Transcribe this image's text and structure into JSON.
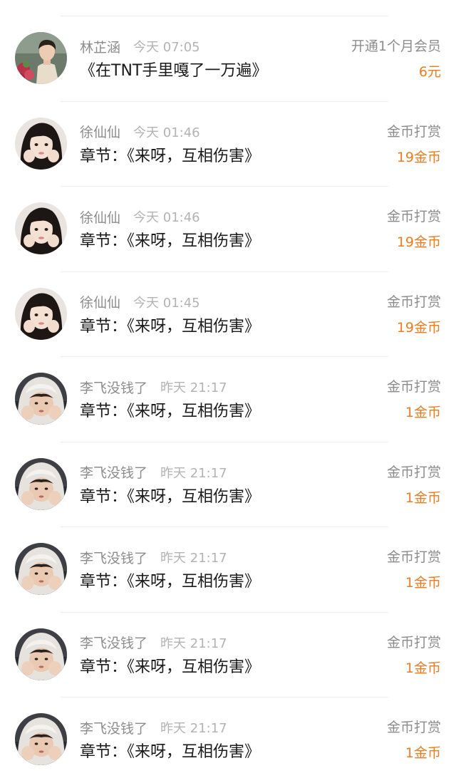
{
  "accent_color": "#f07b1c",
  "records": [
    {
      "avatar_icon": "avatar-photo-man-with-flowers",
      "username": "林芷涵",
      "time": "今天 07:05",
      "content": "《在TNT手里嘎了一万遍》",
      "type": "开通1个月会员",
      "amount": "6元"
    },
    {
      "avatar_icon": "avatar-photo-woman-hands-on-cheeks",
      "username": "徐仙仙",
      "time": "今天 01:46",
      "content": "章节：《来呀，互相伤害》",
      "type": "金币打赏",
      "amount": "19金币"
    },
    {
      "avatar_icon": "avatar-photo-woman-hands-on-cheeks",
      "username": "徐仙仙",
      "time": "今天 01:46",
      "content": "章节：《来呀，互相伤害》",
      "type": "金币打赏",
      "amount": "19金币"
    },
    {
      "avatar_icon": "avatar-photo-woman-hands-on-cheeks",
      "username": "徐仙仙",
      "time": "今天 01:45",
      "content": "章节：《来呀，互相伤害》",
      "type": "金币打赏",
      "amount": "19金币"
    },
    {
      "avatar_icon": "avatar-photo-person-white-hood",
      "username": "李飞没钱了",
      "time": "昨天 21:17",
      "content": "章节：《来呀，互相伤害》",
      "type": "金币打赏",
      "amount": "1金币"
    },
    {
      "avatar_icon": "avatar-photo-person-white-hood",
      "username": "李飞没钱了",
      "time": "昨天 21:17",
      "content": "章节：《来呀，互相伤害》",
      "type": "金币打赏",
      "amount": "1金币"
    },
    {
      "avatar_icon": "avatar-photo-person-white-hood",
      "username": "李飞没钱了",
      "time": "昨天 21:17",
      "content": "章节：《来呀，互相伤害》",
      "type": "金币打赏",
      "amount": "1金币"
    },
    {
      "avatar_icon": "avatar-photo-person-white-hood",
      "username": "李飞没钱了",
      "time": "昨天 21:17",
      "content": "章节：《来呀，互相伤害》",
      "type": "金币打赏",
      "amount": "1金币"
    },
    {
      "avatar_icon": "avatar-photo-person-white-hood",
      "username": "李飞没钱了",
      "time": "昨天 21:17",
      "content": "章节：《来呀，互相伤害》",
      "type": "金币打赏",
      "amount": "1金币"
    }
  ]
}
